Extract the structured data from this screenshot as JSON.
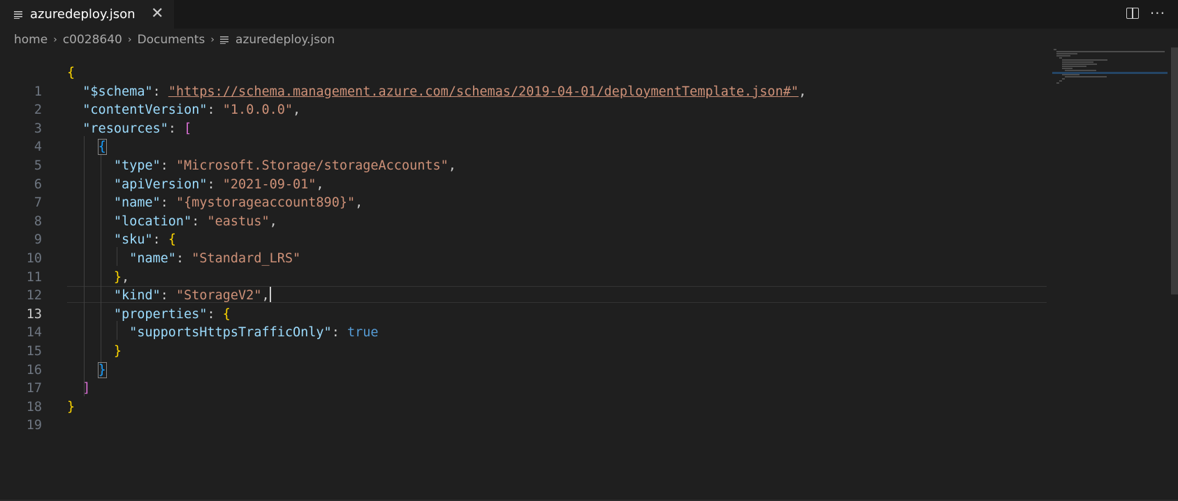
{
  "tab": {
    "title": "azuredeploy.json",
    "close_glyph": "✕",
    "icon": "file-lines-icon"
  },
  "actions": {
    "split_icon": "split-editor-icon",
    "more_glyph": "···"
  },
  "breadcrumb": {
    "items": [
      "home",
      "c0028640",
      "Documents"
    ],
    "file": "azuredeploy.json",
    "separator": "›"
  },
  "editor": {
    "active_line": 13,
    "lines": [
      "1",
      "2",
      "3",
      "4",
      "5",
      "6",
      "7",
      "8",
      "9",
      "10",
      "11",
      "12",
      "13",
      "14",
      "15",
      "16",
      "17",
      "18",
      "19"
    ],
    "code": {
      "l1_open": "{",
      "schema_key": "\"$schema\"",
      "schema_val": "\"https://schema.management.azure.com/schemas/2019-04-01/deploymentTemplate.json#\"",
      "cv_key": "\"contentVersion\"",
      "cv_val": "\"1.0.0.0\"",
      "res_key": "\"resources\"",
      "res_open": "[",
      "obj_open": "{",
      "type_key": "\"type\"",
      "type_val": "\"Microsoft.Storage/storageAccounts\"",
      "api_key": "\"apiVersion\"",
      "api_val": "\"2021-09-01\"",
      "name_key": "\"name\"",
      "name_val": "\"{mystorageaccount890}\"",
      "loc_key": "\"location\"",
      "loc_val": "\"eastus\"",
      "sku_key": "\"sku\"",
      "sku_open": "{",
      "sku_name_key": "\"name\"",
      "sku_name_val": "\"Standard_LRS\"",
      "sku_close": "}",
      "kind_key": "\"kind\"",
      "kind_val": "\"StorageV2\"",
      "props_key": "\"properties\"",
      "props_open": "{",
      "https_key": "\"supportsHttpsTrafficOnly\"",
      "https_val": "true",
      "props_close": "}",
      "obj_close": "}",
      "res_close": "]",
      "l19_close": "}"
    }
  },
  "colors": {
    "background": "#1f1f1f",
    "key": "#9cdcfe",
    "string": "#ce9178",
    "bracket_level1": "#ffd700",
    "bracket_level2": "#da70d6",
    "bracket_level3": "#179fff",
    "boolean": "#569cd6"
  }
}
